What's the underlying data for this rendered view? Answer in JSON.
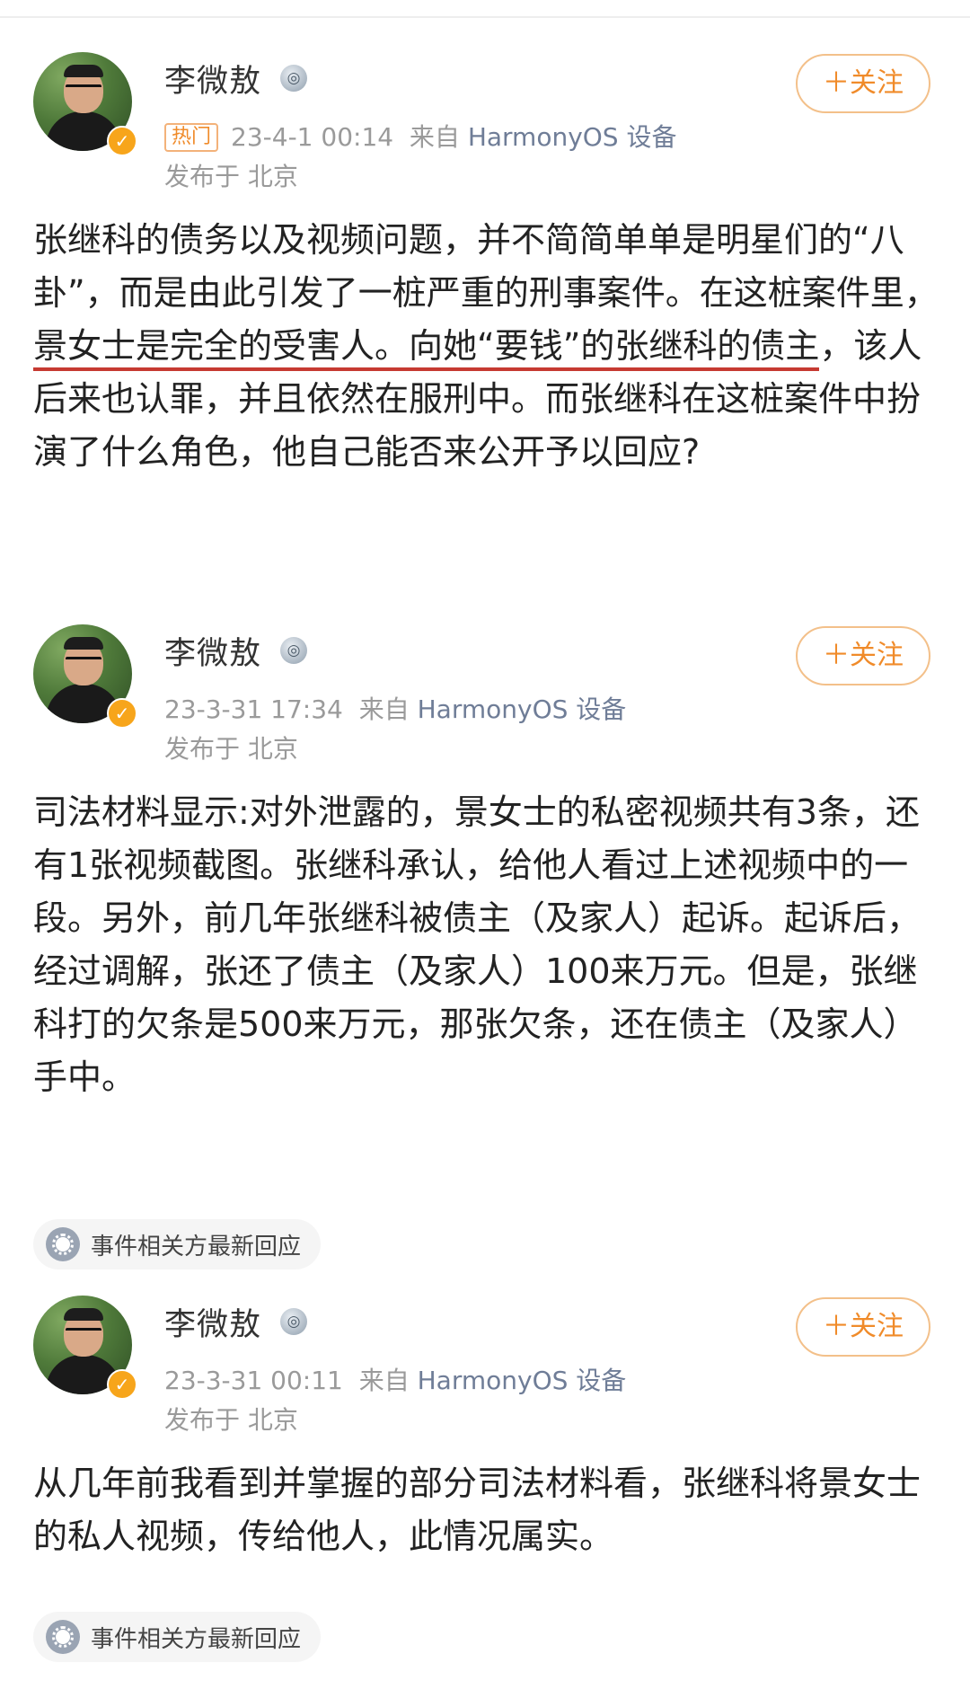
{
  "follow_label": "＋关注",
  "posts": [
    {
      "author": "李微敖",
      "medal": "◎",
      "hot_badge": "热门",
      "time": "23-4-1 00:14",
      "source_prefix": "来自",
      "source": "HarmonyOS 设备",
      "location": "发布于 北京",
      "text_parts": [
        "张继科的债务以及视频问题，并不简简单单是明星们的“八卦”，而是由此引发了一桩严重的刑事案件。在这桩案件里，",
        "景女士是完全的受害人。向她“要钱”的张继科的债主",
        "，该人后来也认罪，并且依然在服刑中。而张继科在这桩案件中扮演了什么角色，他自己能否来公开予以回应?"
      ]
    },
    {
      "author": "李微敖",
      "medal": "◎",
      "time": "23-3-31 17:34",
      "source_prefix": "来自",
      "source": "HarmonyOS 设备",
      "location": "发布于 北京",
      "text": "司法材料显示:对外泄露的，景女士的私密视频共有3条，还有1张视频截图。张继科承认，给他人看过上述视频中的一段。另外，前几年张继科被债主（及家人）起诉。起诉后，经过调解，张还了债主（及家人）100来万元。但是，张继科打的欠条是500来万元，那张欠条，还在债主（及家人）手中。",
      "tag": "事件相关方最新回应"
    },
    {
      "author": "李微敖",
      "medal": "◎",
      "time": "23-3-31 00:11",
      "source_prefix": "来自",
      "source": "HarmonyOS 设备",
      "location": "发布于 北京",
      "text": "从几年前我看到并掌握的部分司法材料看，张继科将景女士的私人视频，传给他人，此情况属实。",
      "tag": "事件相关方最新回应"
    }
  ],
  "colors": {
    "accent": "#f08b2a",
    "underline": "#c63a32",
    "meta": "#9a9a9a",
    "source": "#6f7d97",
    "verified": "#f7a51b"
  },
  "icons": {
    "verified": "verified-badge-icon",
    "medal": "medal-icon",
    "tag": "topic-icon"
  }
}
